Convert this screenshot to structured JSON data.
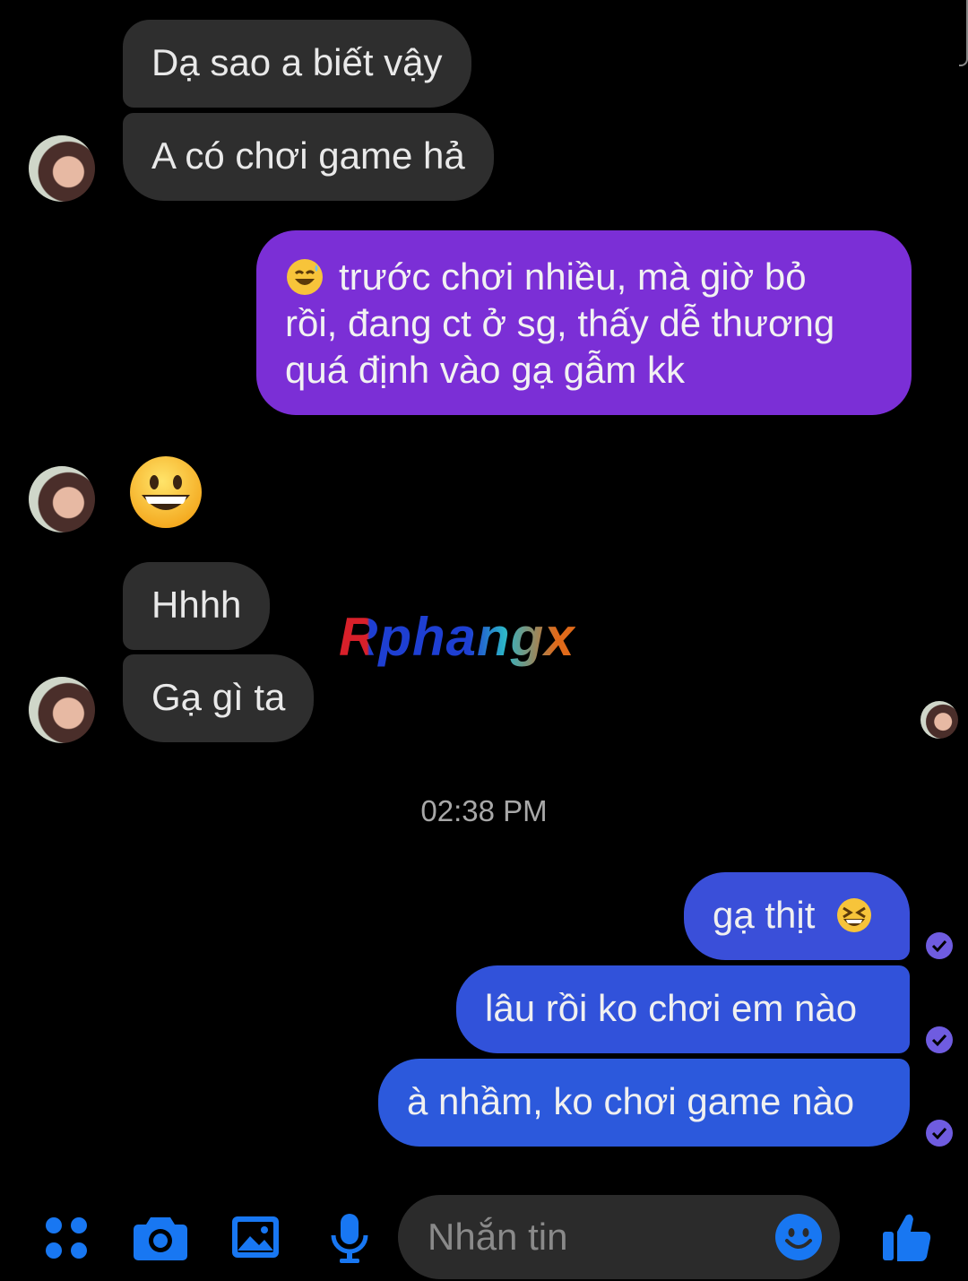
{
  "messages": {
    "in1": "Dạ sao a biết vậy",
    "in2": "A có chơi game hả",
    "out1_line1": "trước chơi nhiều, mà giờ bỏ",
    "out1_line2": "rồi, đang ct ở sg, thấy dễ thương",
    "out1_line3": "quá định vào gạ gẫm kk",
    "in4": "Hhhh",
    "in5": "Gạ gì ta",
    "out2": "gạ thịt",
    "out3": "lâu rồi ko chơi em nào",
    "out4": "à nhầm, ko chơi game nào"
  },
  "timestamp": "02:38 PM",
  "watermark": "Rphangx",
  "composer": {
    "placeholder": "Nhắn tin"
  },
  "colors": {
    "incoming": "#2e2e2e",
    "outgoing_purple": "#7b2fd6",
    "outgoing_blue": "#2f56d8",
    "accent": "#1877f2",
    "composer_bg": "#2b2b2b"
  },
  "icons": [
    "apps-icon",
    "camera-icon",
    "gallery-icon",
    "mic-icon",
    "emoji-icon",
    "like-icon",
    "sweat-smile-emoji",
    "grin-emoji",
    "laugh-emoji",
    "seen-check-icon"
  ]
}
